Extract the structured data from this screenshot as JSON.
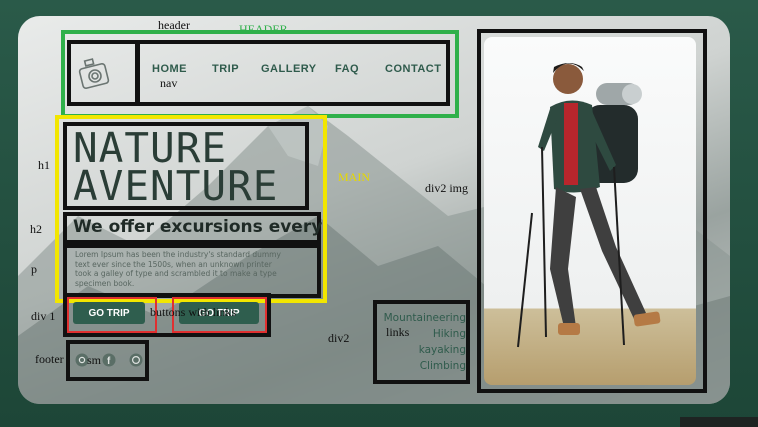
{
  "labels": {
    "header": "header",
    "header_caps": "HEADER",
    "nav": "nav",
    "h1": "h1",
    "h2": "h2",
    "p": "p",
    "div1": "div 1",
    "buttons_with_links": "buttons with links",
    "footer": "footer",
    "sm": "sm",
    "main": "MAIN",
    "div2_img": "div2 img",
    "div2": "div2",
    "links": "links"
  },
  "nav": {
    "items": [
      "HOME",
      "TRIP",
      "GALLERY",
      "FAQ",
      "CONTACT"
    ]
  },
  "hero": {
    "title_line1": "NATURE",
    "title_line2": "AVENTURE",
    "subtitle": "We offer excursions every",
    "paragraph": "Lorem Ipsum has been the industry's standard dummy text ever since the 1500s, when an unknown printer took a galley of type and scrambled it to make a type specimen book."
  },
  "buttons": {
    "go_trip": "GO TRIP",
    "second": "GO TRIP"
  },
  "side_links": [
    "Mountaineering",
    "Hiking",
    "kayaking",
    "Climbing"
  ],
  "colors": {
    "accent_green": "#2f5e4e",
    "header_outline": "#2fb04a",
    "main_outline": "#f2e600",
    "button_outline": "#e03030"
  },
  "icons": [
    "camera-icon",
    "instagram-icon",
    "facebook-icon",
    "whatsapp-icon"
  ]
}
